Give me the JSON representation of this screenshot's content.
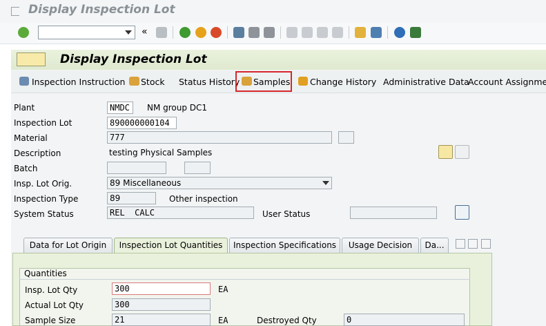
{
  "window": {
    "title": "Display Inspection Lot"
  },
  "toolbar": {
    "command_value": ""
  },
  "screen": {
    "title": "Display Inspection Lot"
  },
  "app_toolbar": {
    "items": [
      "Inspection Instruction",
      "Stock",
      "Status History",
      "Samples",
      "Change History",
      "Administrative Data",
      "Account Assignment"
    ]
  },
  "form": {
    "plant": {
      "label": "Plant",
      "value": "NMDC",
      "text": "NM group DC1"
    },
    "inspection_lot": {
      "label": "Inspection Lot",
      "value": "890000000104"
    },
    "material": {
      "label": "Material",
      "value": "777"
    },
    "description": {
      "label": "Description",
      "value": "testing Physical Samples"
    },
    "batch": {
      "label": "Batch",
      "value": ""
    },
    "insp_lot_origin": {
      "label": "Insp. Lot Orig.",
      "value": "89 Miscellaneous"
    },
    "inspection_type": {
      "label": "Inspection Type",
      "value": "89",
      "text": "Other inspection"
    },
    "system_status": {
      "label": "System Status",
      "value": "REL  CALC"
    },
    "user_status": {
      "label": "User Status",
      "value": ""
    }
  },
  "tabs": [
    {
      "label": "Data for Lot Origin",
      "active": false
    },
    {
      "label": "Inspection Lot Quantities",
      "active": true
    },
    {
      "label": "Inspection Specifications",
      "active": false
    },
    {
      "label": "Usage Decision",
      "active": false
    },
    {
      "label": "Da...",
      "active": false
    }
  ],
  "quantities": {
    "title": "Quantities",
    "insp_lot_qty": {
      "label": "Insp. Lot Qty",
      "value": "300",
      "unit": "EA"
    },
    "actual_lot_qty": {
      "label": "Actual Lot Qty",
      "value": "300"
    },
    "sample_size": {
      "label": "Sample Size",
      "value": "21",
      "unit": "EA"
    },
    "destroyed_qty": {
      "label": "Destroyed Qty",
      "value": "0"
    }
  },
  "colors": {
    "highlight": "#d6262a",
    "header_band": "#dfe9cf",
    "tab_active": "#e9f1dc"
  }
}
